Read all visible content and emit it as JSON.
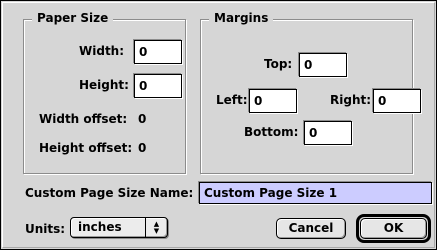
{
  "paper_size": {
    "title": "Paper Size",
    "width_label": "Width:",
    "width_value": "0",
    "height_label": "Height:",
    "height_value": "0",
    "width_offset_label": "Width offset:",
    "width_offset_value": "0",
    "height_offset_label": "Height offset:",
    "height_offset_value": "0"
  },
  "margins": {
    "title": "Margins",
    "top_label": "Top:",
    "top_value": "0",
    "left_label": "Left:",
    "left_value": "0",
    "right_label": "Right:",
    "right_value": "0",
    "bottom_label": "Bottom:",
    "bottom_value": "0"
  },
  "custom_name": {
    "label": "Custom Page Size Name:",
    "value": "Custom Page Size 1"
  },
  "units": {
    "label": "Units:",
    "selected": "inches"
  },
  "buttons": {
    "cancel": "Cancel",
    "ok": "OK"
  },
  "colors": {
    "dialog_bg": "#d6d6d6",
    "selection_bg": "#ccccff"
  },
  "icons": {
    "popup_arrows": "up-down-arrows-icon"
  }
}
